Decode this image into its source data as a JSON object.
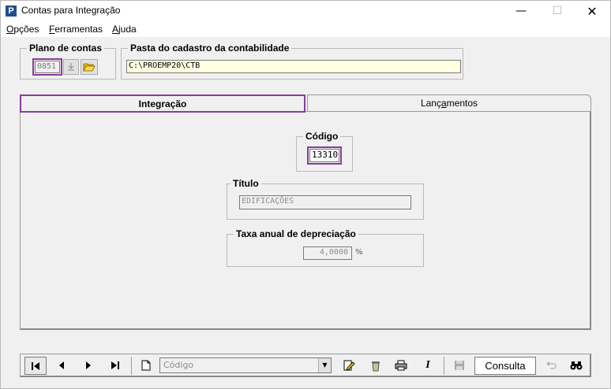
{
  "window": {
    "title": "Contas para Integração",
    "app_icon_letter": "P",
    "minimize_glyph": "—",
    "maximize_glyph": "☐",
    "close_glyph": "✕"
  },
  "menu": {
    "opcoes": {
      "underline": "O",
      "rest": "pções"
    },
    "ferramentas": {
      "underline": "F",
      "rest": "erramentas"
    },
    "ajuda": {
      "underline": "A",
      "rest": "juda"
    }
  },
  "plano": {
    "legend": "Plano de contas",
    "value": "0851"
  },
  "pasta": {
    "legend": "Pasta do cadastro da contabilidade",
    "value": "C:\\PROEMP20\\CTB"
  },
  "tabs": [
    {
      "label": "Integração",
      "active": true
    },
    {
      "label_pre": "Lanç",
      "label_underline": "a",
      "label_post": "mentos",
      "active": false
    }
  ],
  "codigo": {
    "legend": "Código",
    "value": "13310"
  },
  "titulo": {
    "legend": "Título",
    "value": "EDIFICAÇÕES"
  },
  "taxa": {
    "legend": "Taxa anual de depreciação",
    "value": "4,0000",
    "unit": "%"
  },
  "toolbar": {
    "combo_placeholder": "Código",
    "consulta_label": "Consulta",
    "italic_label": "I"
  },
  "colors": {
    "highlight": "#8a3b9c",
    "field_yellow": "#ffffe1",
    "app_icon_blue": "#1f4e8f"
  }
}
